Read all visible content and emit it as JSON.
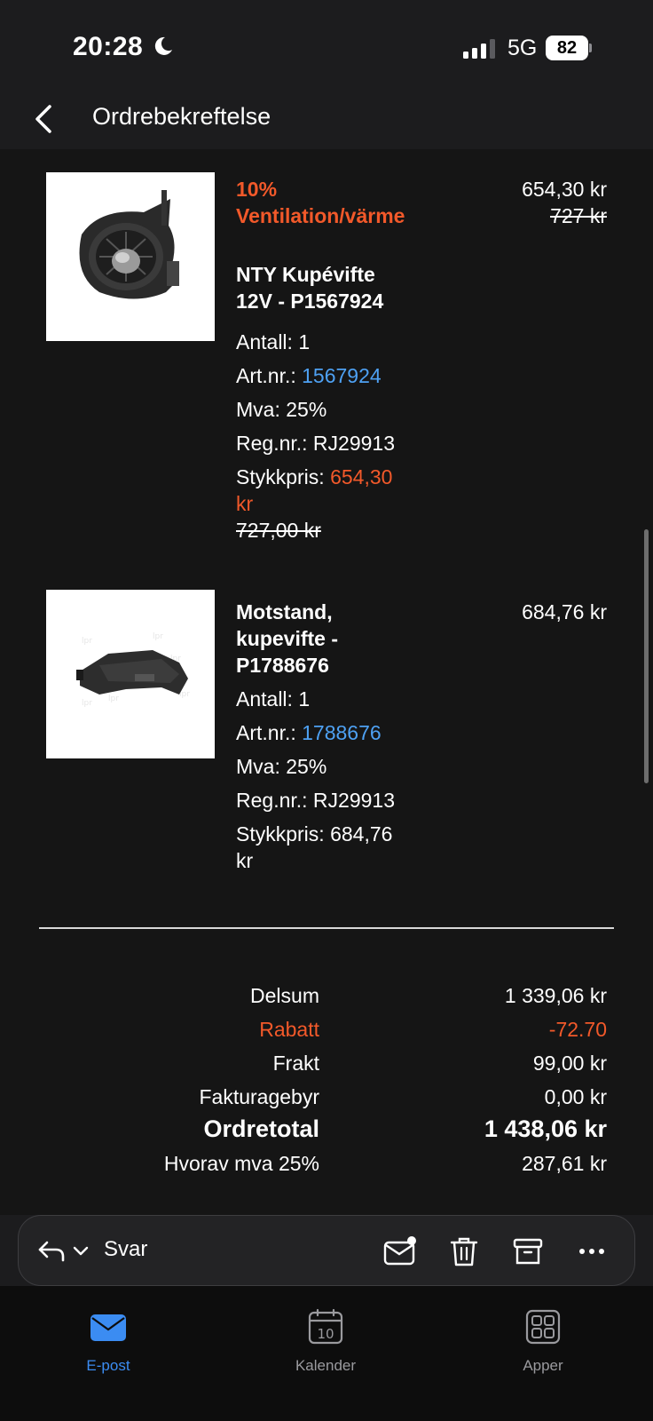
{
  "status_bar": {
    "time": "20:28",
    "network": "5G",
    "battery": "82"
  },
  "nav": {
    "title": "Ordrebekreftelse"
  },
  "products": [
    {
      "discount_label": "10% Ventilation/värme",
      "name": "NTY Kupévifte 12V - P1567924",
      "quantity_label": "Antall: 1",
      "art_label": "Art.nr.:",
      "art_number": "1567924",
      "vat": "Mva: 25%",
      "reg": "Reg.nr.: RJ29913",
      "unit_label": "Stykkpris:",
      "unit_price": "654,30 kr",
      "unit_price_old": "727,00 kr",
      "price": "654,30 kr",
      "price_old": "727 kr"
    },
    {
      "name": "Motstand, kupevifte - P1788676",
      "quantity_label": "Antall: 1",
      "art_label": "Art.nr.:",
      "art_number": "1788676",
      "vat": "Mva: 25%",
      "reg": "Reg.nr.: RJ29913",
      "unit_label": "Stykkpris:",
      "unit_price": "684,76 kr",
      "price": "684,76 kr"
    }
  ],
  "summary": {
    "subtotal_label": "Delsum",
    "subtotal": "1 339,06 kr",
    "discount_label": "Rabatt",
    "discount": "-72.70",
    "shipping_label": "Frakt",
    "shipping": "99,00 kr",
    "invoice_fee_label": "Fakturagebyr",
    "invoice_fee": "0,00 kr",
    "total_label": "Ordretotal",
    "total": "1 438,06 kr",
    "vat_label": "Hvorav mva 25%",
    "vat": "287,61 kr"
  },
  "toolbar": {
    "reply_label": "Svar"
  },
  "tabs": [
    {
      "label": "E-post",
      "active": true
    },
    {
      "label": "Kalender",
      "day": "10"
    },
    {
      "label": "Apper"
    }
  ],
  "colors": {
    "accent_orange": "#f2592a",
    "link_blue": "#4ea1f3",
    "tab_active": "#3b8cf2"
  }
}
